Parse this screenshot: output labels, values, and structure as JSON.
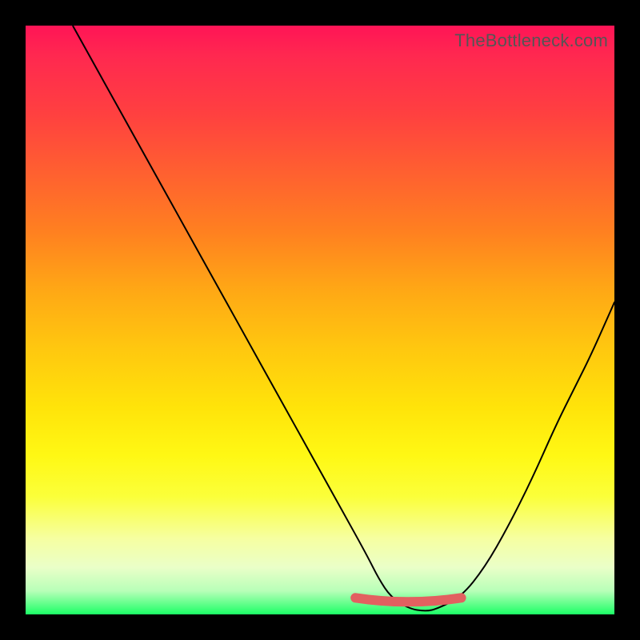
{
  "watermark": "TheBottleneck.com",
  "chart_data": {
    "type": "line",
    "title": "",
    "xlabel": "",
    "ylabel": "",
    "xlim": [
      0,
      100
    ],
    "ylim": [
      0,
      100
    ],
    "grid": false,
    "series": [
      {
        "name": "bottleneck-curve",
        "x": [
          8,
          13,
          18,
          23,
          28,
          33,
          38,
          43,
          48,
          53,
          58,
          60,
          62,
          65,
          68,
          70,
          74,
          78,
          82,
          86,
          90,
          93,
          96,
          100
        ],
        "y": [
          100,
          91,
          82,
          73,
          64,
          55,
          46,
          37,
          28,
          19,
          10,
          6,
          3,
          1,
          0.5,
          1,
          3,
          8,
          15,
          23,
          32,
          38,
          44,
          53
        ]
      }
    ],
    "annotations": [
      {
        "name": "optimal-zone-marker",
        "x_range": [
          56,
          74
        ],
        "y": 2,
        "style": "coral-thick"
      }
    ]
  }
}
